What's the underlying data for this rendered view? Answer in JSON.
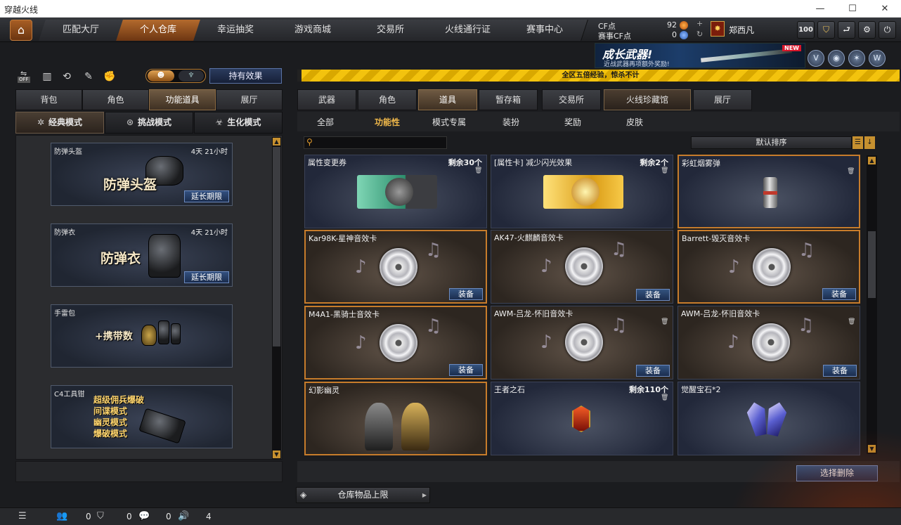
{
  "window": {
    "title": "穿越火线",
    "minimize": "—",
    "maximize": "☐",
    "close": "✕"
  },
  "nav": {
    "home_icon": "home-icon",
    "tabs": [
      "匹配大厅",
      "个人仓库",
      "幸运抽奖",
      "游戏商城",
      "交易所",
      "火线通行证",
      "赛事中心"
    ],
    "active_tab": "个人仓库"
  },
  "currency": {
    "cf_label": "CF点",
    "cf_value": "92",
    "event_cf_label": "赛事CF点",
    "event_cf_value": "0",
    "plus": "+",
    "refresh": "↻"
  },
  "player": {
    "name": "郑西凡"
  },
  "system_buttons": {
    "level": "100",
    "shield": "⛉",
    "back": "⮐",
    "settings": "⚙",
    "power": "⏻"
  },
  "banner": {
    "title": "成长武器!",
    "subtitle": "近战武器再项额外奖励!",
    "badge": "NEW"
  },
  "left": {
    "tools": {
      "off_label": "OFF"
    },
    "effect_button": "持有效果",
    "tabs": [
      "背包",
      "角色",
      "功能道具",
      "展厅"
    ],
    "active_tab": "功能道具",
    "modes": [
      "经典模式",
      "挑战模式",
      "生化模式"
    ],
    "active_mode": "经典模式",
    "cards": [
      {
        "name": "防弹头盔",
        "time": "4天 21小时",
        "big": "防弹头盔",
        "button": "延长期限"
      },
      {
        "name": "防弹衣",
        "time": "4天 21小时",
        "big": "防弹衣",
        "button": "延长期限"
      },
      {
        "name": "手雷包",
        "big": "+携带数"
      },
      {
        "name": "C4工具钳",
        "lines": [
          "超级佣兵爆破",
          "间谍模式",
          "幽灵模式",
          "爆破模式"
        ]
      }
    ]
  },
  "notice": "全区五倍经验，惊杀不计",
  "right": {
    "tabs": [
      "武器",
      "角色",
      "道具",
      "暂存箱",
      "交易所",
      "火线珍藏馆",
      "展厅"
    ],
    "active_tab": "道具",
    "subtabs": [
      "全部",
      "功能性",
      "模式专属",
      "装扮",
      "奖励",
      "皮肤"
    ],
    "active_subtab": "功能性",
    "search_placeholder": "",
    "sort": "默认排序",
    "items": [
      {
        "name": "属性变更券",
        "count": "剩余30个"
      },
      {
        "name": "[属性卡] 减少闪光效果",
        "count": "剩余2个"
      },
      {
        "name": "彩虹烟雾弹"
      },
      {
        "name": "Kar98K-星神音效卡",
        "button": "装备"
      },
      {
        "name": "AK47-火麒麟音效卡",
        "button": "装备"
      },
      {
        "name": "Barrett-毁灭音效卡",
        "button": "装备"
      },
      {
        "name": "M4A1-黑骑士音效卡",
        "button": "装备"
      },
      {
        "name": "AWM-吕龙-怀旧音效卡",
        "button": "装备"
      },
      {
        "name": "AWM-吕龙-怀旧音效卡",
        "button": "装备"
      },
      {
        "name": "幻影幽灵"
      },
      {
        "name": "王者之石",
        "count": "剩余110个"
      },
      {
        "name": "觉醒宝石*2"
      }
    ],
    "delete_button": "选择删除",
    "capacity_button": "仓库物品上限"
  },
  "statusbar": {
    "friends": "0",
    "clan": "0",
    "messages": "0",
    "volume": "4"
  },
  "colors": {
    "accent_orange": "#c77c2b",
    "notice_yellow": "#f3c30e",
    "button_blue": "#34537f"
  }
}
